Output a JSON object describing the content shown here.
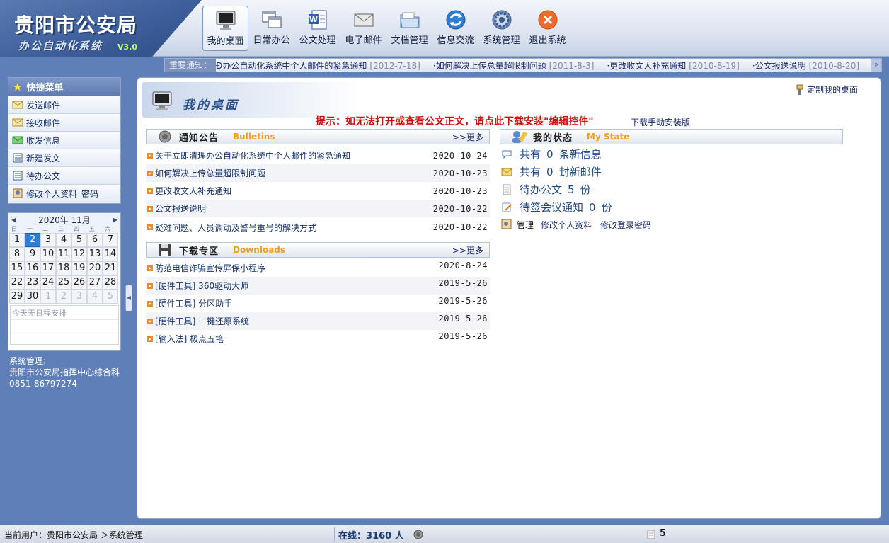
{
  "app": {
    "title": "贵阳市公安局",
    "subtitle": "办公自动化系统",
    "version": "V3.0"
  },
  "nav": [
    {
      "label": "我的桌面",
      "icon": "monitor-icon",
      "active": true
    },
    {
      "label": "日常办公",
      "icon": "windows-icon",
      "active": false
    },
    {
      "label": "公文处理",
      "icon": "word-document-icon",
      "active": false
    },
    {
      "label": "电子邮件",
      "icon": "envelope-icon",
      "active": false
    },
    {
      "label": "文档管理",
      "icon": "folder-icon",
      "active": false
    },
    {
      "label": "信息交流",
      "icon": "refresh-globe-icon",
      "active": false
    },
    {
      "label": "系统管理",
      "icon": "gear-icon",
      "active": false
    },
    {
      "label": "退出系统",
      "icon": "close-circle-icon",
      "active": false
    }
  ],
  "ticker": {
    "label": "重要通知：",
    "items": [
      {
        "text": "Ð办公自动化系统中个人邮件的紧急通知",
        "date": "[2012-7-18]"
      },
      {
        "text": "·如何解决上传总量超限制问题",
        "date": "[2011-8-3]"
      },
      {
        "text": "·更改收文人补充通知",
        "date": "[2010-8-19]"
      },
      {
        "text": "·公文报送说明",
        "date": "[2010-8-20]"
      }
    ],
    "arrow": "»"
  },
  "quick_menu": {
    "title": "快捷菜单",
    "items": [
      {
        "label": "发送邮件",
        "icon": "mail-send-icon"
      },
      {
        "label": "接收邮件",
        "icon": "mail-receive-icon"
      },
      {
        "label": "收发信息",
        "icon": "message-icon"
      },
      {
        "label": "新建发文",
        "icon": "new-document-icon"
      },
      {
        "label": "待办公文",
        "icon": "pending-document-icon"
      },
      {
        "label": "修改个人资料",
        "label2": "密码",
        "icon": "profile-edit-icon"
      }
    ]
  },
  "calendar": {
    "year_label": "2020年",
    "month_label": "11月",
    "prev": "◀",
    "next": "▶",
    "weekdays": [
      "日",
      "一",
      "二",
      "三",
      "四",
      "五",
      "六"
    ],
    "days": [
      {
        "d": "1",
        "other": false
      },
      {
        "d": "2",
        "other": false,
        "today": true
      },
      {
        "d": "3",
        "other": false
      },
      {
        "d": "4",
        "other": false
      },
      {
        "d": "5",
        "other": false
      },
      {
        "d": "6",
        "other": false
      },
      {
        "d": "7",
        "other": false
      },
      {
        "d": "8",
        "other": false
      },
      {
        "d": "9",
        "other": false
      },
      {
        "d": "10",
        "other": false
      },
      {
        "d": "11",
        "other": false
      },
      {
        "d": "12",
        "other": false
      },
      {
        "d": "13",
        "other": false
      },
      {
        "d": "14",
        "other": false
      },
      {
        "d": "15",
        "other": false
      },
      {
        "d": "16",
        "other": false
      },
      {
        "d": "17",
        "other": false
      },
      {
        "d": "18",
        "other": false
      },
      {
        "d": "19",
        "other": false
      },
      {
        "d": "20",
        "other": false
      },
      {
        "d": "21",
        "other": false
      },
      {
        "d": "22",
        "other": false
      },
      {
        "d": "23",
        "other": false
      },
      {
        "d": "24",
        "other": false
      },
      {
        "d": "25",
        "other": false
      },
      {
        "d": "26",
        "other": false
      },
      {
        "d": "27",
        "other": false
      },
      {
        "d": "28",
        "other": false
      },
      {
        "d": "29",
        "other": false
      },
      {
        "d": "30",
        "other": false
      },
      {
        "d": "1",
        "other": true
      },
      {
        "d": "2",
        "other": true
      },
      {
        "d": "3",
        "other": true
      },
      {
        "d": "4",
        "other": true
      },
      {
        "d": "5",
        "other": true
      }
    ],
    "note": "今天无日程安排"
  },
  "sys_info": {
    "label": "系统管理:",
    "org": "贵阳市公安局指挥中心综合科",
    "phone": "0851-86797274"
  },
  "desk": {
    "title": "我的桌面",
    "customize": "定制我的桌面",
    "tip": "提示：如无法打开或查看公文正文，请点此下载安装\"编辑控件\"",
    "manual_link": "下载手动安装版"
  },
  "bulletins": {
    "title": "通知公告",
    "en": "Bulletins",
    "more": ">>更多",
    "items": [
      {
        "title": "关于立即清理办公自动化系统中个人邮件的紧急通知",
        "date": "2020-10-24"
      },
      {
        "title": "如何解决上传总量超限制问题",
        "date": "2020-10-23"
      },
      {
        "title": "更改收文人补充通知",
        "date": "2020-10-23"
      },
      {
        "title": "公文报送说明",
        "date": "2020-10-22"
      },
      {
        "title": "疑难问题、人员调动及警号重号的解决方式",
        "date": "2020-10-22"
      }
    ]
  },
  "downloads": {
    "title": "下载专区",
    "en": "Downloads",
    "more": ">>更多",
    "items": [
      {
        "title": "防范电信诈骗宣传屏保小程序",
        "date": "2020-8-24"
      },
      {
        "title": "[硬件工具] 360驱动大师",
        "date": "2019-5-26"
      },
      {
        "title": "[硬件工具] 分区助手",
        "date": "2019-5-26"
      },
      {
        "title": "[硬件工具] 一键还原系统",
        "date": "2019-5-26"
      },
      {
        "title": "[输入法] 极点五笔",
        "date": "2019-5-26"
      }
    ]
  },
  "my_state": {
    "title": "我的状态",
    "en": "My State",
    "rows": [
      {
        "pre": "共有",
        "num": "0",
        "post": "条新信息",
        "icon": "message-bubble-icon"
      },
      {
        "pre": "共有",
        "num": "0",
        "post": "封新邮件",
        "icon": "envelope-icon"
      },
      {
        "pre": "待办公文",
        "num": "5",
        "post": "份",
        "icon": "document-icon"
      },
      {
        "pre": "待签会议通知",
        "num": "0",
        "post": "份",
        "icon": "sign-pen-icon"
      }
    ],
    "admin_label": "管理",
    "admin_links": [
      "修改个人资料",
      "修改登录密码"
    ]
  },
  "statusbar": {
    "user": "当前用户：贵阳市公安局 ＞系统管理",
    "online": "在线：3160 人",
    "count": "5"
  }
}
